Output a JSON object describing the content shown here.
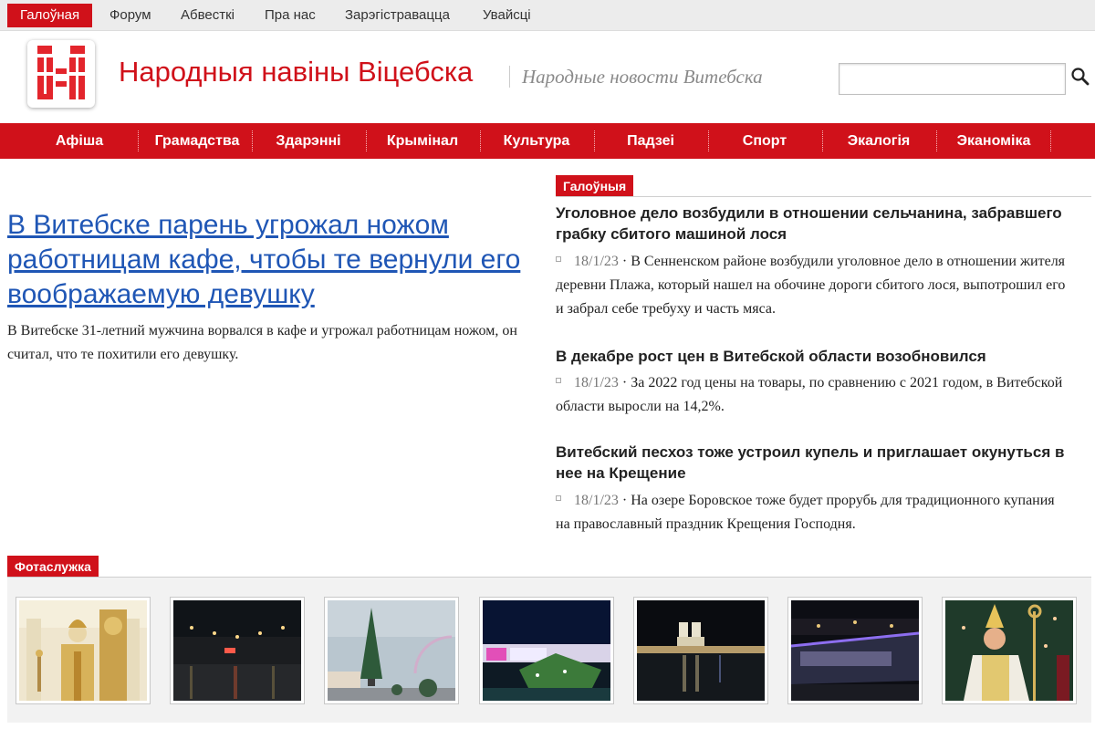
{
  "topnav": {
    "items": [
      {
        "label": "Галоўная"
      },
      {
        "label": "Форум"
      },
      {
        "label": "Абвесткі"
      },
      {
        "label": "Пра нас"
      },
      {
        "label": "Зарэгістравацца"
      },
      {
        "label": "Увайсці"
      }
    ],
    "active_index": 0
  },
  "header": {
    "title": "Народныя навіны Віцебска",
    "subtitle": "Народные новости Витебска",
    "search": {
      "value": "",
      "placeholder": ""
    }
  },
  "categories": [
    "Афіша",
    "Грамадства",
    "Здарэнні",
    "Крымінал",
    "Культура",
    "Падзеі",
    "Спорт",
    "Экалогія",
    "Эканоміка"
  ],
  "lead": {
    "title": "В Витебске парень угрожал ножом работницам кафе, чтобы те вернули его воображаемую девушку",
    "summary": "В Витебске 31-летний мужчина ворвался в кафе и угрожал работницам ножом, он считал, что те похитили его девушку."
  },
  "main_section": {
    "label": "Галоўныя",
    "articles": [
      {
        "title": "Уголовное дело возбудили в отношении сельчанина, забравшего грабку сбитого машиной лося",
        "date": "18/1/23",
        "text": "В Сенненском районе возбудили уголовное дело в отношении жителя деревни Плажа, который нашел на обочине дороги сбитого лося, выпотрошил его и забрал себе требуху и часть мяса."
      },
      {
        "title": "В декабре рост цен в Витебской области возобновился",
        "date": "18/1/23",
        "text": "За 2022 год цены на товары, по сравнению с 2021 годом, в Витебской области выросли на 14,2%."
      },
      {
        "title": "Витебский песхоз тоже устроил купель и приглашает окунуться в нее на Крещение",
        "date": "18/1/23",
        "text": "На озере Боровское тоже будет прорубь для традиционного купания на православный праздник Крещения Господня."
      }
    ]
  },
  "photos_section": {
    "label": "Фотаслужка",
    "photos": [
      "church-bishop",
      "night-street",
      "christmas-tree-rainbow",
      "illuminated-square",
      "night-cathedral-river",
      "night-tram",
      "catholic-bishop"
    ]
  },
  "colors": {
    "brand_red": "#d0111a",
    "link_blue": "#1f56b5"
  }
}
